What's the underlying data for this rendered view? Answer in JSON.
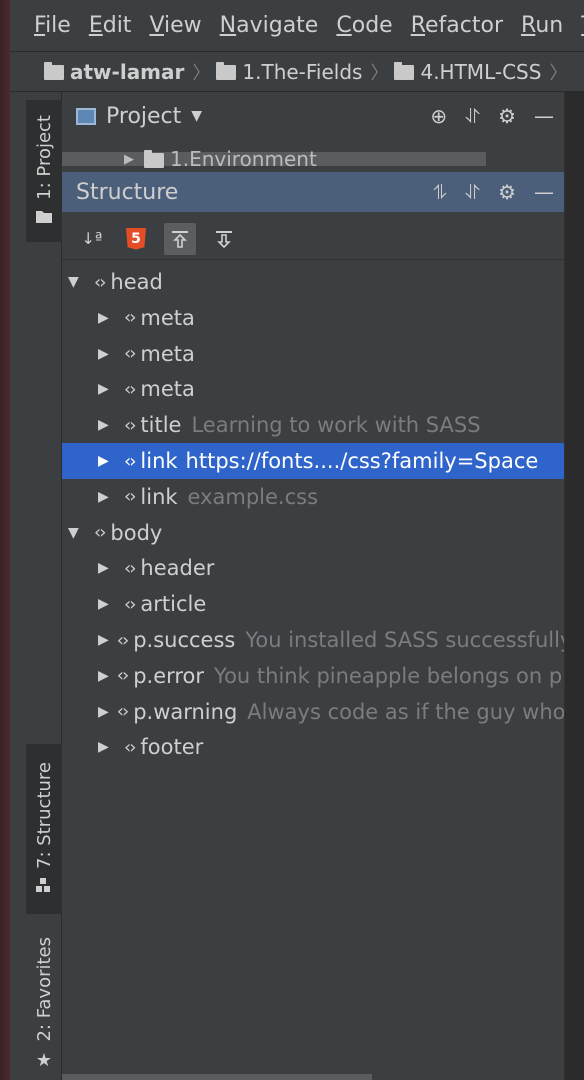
{
  "menu": {
    "items": [
      {
        "first": "F",
        "rest": "ile"
      },
      {
        "first": "E",
        "rest": "dit"
      },
      {
        "first": "V",
        "rest": "iew"
      },
      {
        "first": "N",
        "rest": "avigate"
      },
      {
        "first": "C",
        "rest": "ode"
      },
      {
        "first": "R",
        "rest": "efactor"
      },
      {
        "first": "R",
        "rest": "un"
      },
      {
        "first": "T",
        "rest": ""
      }
    ]
  },
  "breadcrumb": [
    "atw-lamar",
    "1.The-Fields",
    "4.HTML-CSS"
  ],
  "tool_windows": {
    "project": "1: Project",
    "structure": "7: Structure",
    "favorites": "2: Favorites"
  },
  "project_panel": {
    "title": "Project",
    "visible_item": "1.Environment"
  },
  "structure_panel": {
    "title": "Structure"
  },
  "tree": [
    {
      "depth": 0,
      "expanded": true,
      "tag": "head",
      "hint": ""
    },
    {
      "depth": 1,
      "expanded": false,
      "tag": "meta",
      "hint": ""
    },
    {
      "depth": 1,
      "expanded": false,
      "tag": "meta",
      "hint": ""
    },
    {
      "depth": 1,
      "expanded": false,
      "tag": "meta",
      "hint": ""
    },
    {
      "depth": 1,
      "expanded": false,
      "tag": "title",
      "hint": "Learning to work with SASS"
    },
    {
      "depth": 1,
      "expanded": false,
      "tag": "link",
      "hint": "https://fonts..../css?family=Space",
      "selected": true
    },
    {
      "depth": 1,
      "expanded": false,
      "tag": "link",
      "hint": "example.css"
    },
    {
      "depth": 0,
      "expanded": true,
      "tag": "body",
      "hint": ""
    },
    {
      "depth": 1,
      "expanded": false,
      "tag": "header",
      "hint": ""
    },
    {
      "depth": 1,
      "expanded": false,
      "tag": "article",
      "hint": ""
    },
    {
      "depth": 1,
      "expanded": false,
      "tag": "p.success",
      "hint": "You installed SASS successfully"
    },
    {
      "depth": 1,
      "expanded": false,
      "tag": "p.error",
      "hint": "You think pineapple belongs on pizza"
    },
    {
      "depth": 1,
      "expanded": false,
      "tag": "p.warning",
      "hint": "Always code as if the guy who"
    },
    {
      "depth": 1,
      "expanded": false,
      "tag": "footer",
      "hint": ""
    }
  ],
  "colors": {
    "background": "#3c3f41",
    "selection": "#2f65ca",
    "header_active": "#4b5e7a",
    "hint_text": "#7a7d80"
  },
  "icons": {
    "sort": "sort-alpha-icon",
    "html5": "html5-icon",
    "autoscroll_to": "autoscroll-to-source-icon",
    "autoscroll_from": "autoscroll-from-source-icon",
    "locate": "crosshair-icon",
    "collapse": "collapse-icon",
    "settings": "gear-icon",
    "minimize": "minimize-icon"
  }
}
